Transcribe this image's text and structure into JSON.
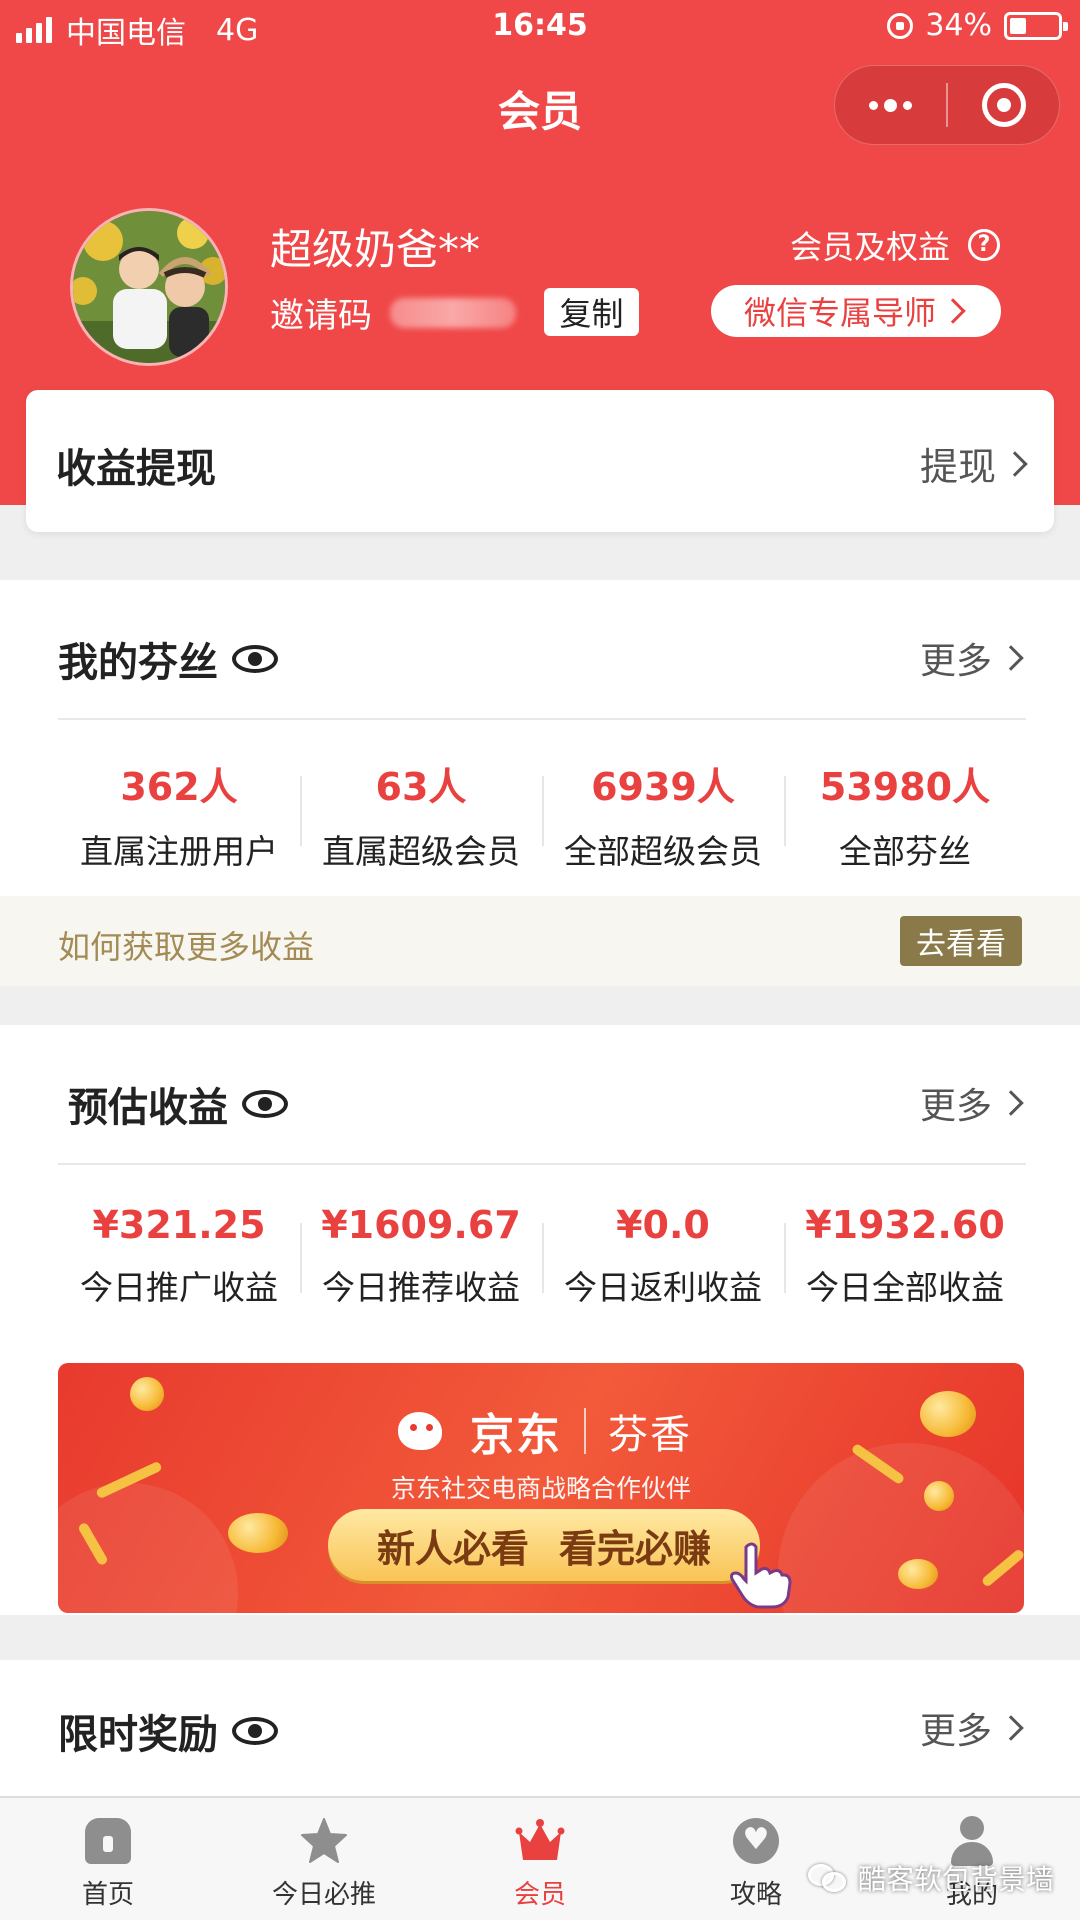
{
  "status_bar": {
    "carrier": "中国电信",
    "network": "4G",
    "time": "16:45",
    "battery": "34%",
    "battery_level": 0.34
  },
  "nav": {
    "title": "会员",
    "menu_icon": "more-dots-icon",
    "close_icon": "target-icon"
  },
  "profile": {
    "name": "超级奶爸**",
    "invite_label": "邀请码",
    "copy_label": "复制",
    "rights_label": "会员及权益",
    "mentor_label": "微信专属导师"
  },
  "withdraw": {
    "title": "收益提现",
    "action": "提现"
  },
  "fans": {
    "title": "我的芬丝",
    "more": "更多",
    "stats": [
      {
        "value": "362人",
        "label": "直属注册用户"
      },
      {
        "value": "63人",
        "label": "直属超级会员"
      },
      {
        "value": "6939人",
        "label": "全部超级会员"
      },
      {
        "value": "53980人",
        "label": "全部芬丝"
      }
    ],
    "promo_text": "如何获取更多收益",
    "promo_button": "去看看"
  },
  "earnings": {
    "title": "预估收益",
    "more": "更多",
    "stats": [
      {
        "value": "¥321.25",
        "label": "今日推广收益"
      },
      {
        "value": "¥1609.67",
        "label": "今日推荐收益"
      },
      {
        "value": "¥0.0",
        "label": "今日返利收益"
      },
      {
        "value": "¥1932.60",
        "label": "今日全部收益"
      }
    ]
  },
  "banner": {
    "brand": "京东",
    "partner": "芬香",
    "subtitle": "京东社交电商战略合作伙伴",
    "cta_left": "新人必看",
    "cta_right": "看完必赚"
  },
  "rewards": {
    "title": "限时奖励",
    "more": "更多"
  },
  "tabbar": {
    "items": [
      {
        "label": "首页",
        "icon": "home-icon"
      },
      {
        "label": "今日必推",
        "icon": "star-icon"
      },
      {
        "label": "会员",
        "icon": "crown-icon",
        "active": true
      },
      {
        "label": "攻略",
        "icon": "heart-badge-icon"
      },
      {
        "label": "我的",
        "icon": "user-icon"
      }
    ]
  },
  "watermark": {
    "text": "酷客软包背景墙"
  },
  "colors": {
    "brand_red": "#f04848",
    "accent_red": "#e94040",
    "promo_gold": "#8a7a4a"
  }
}
